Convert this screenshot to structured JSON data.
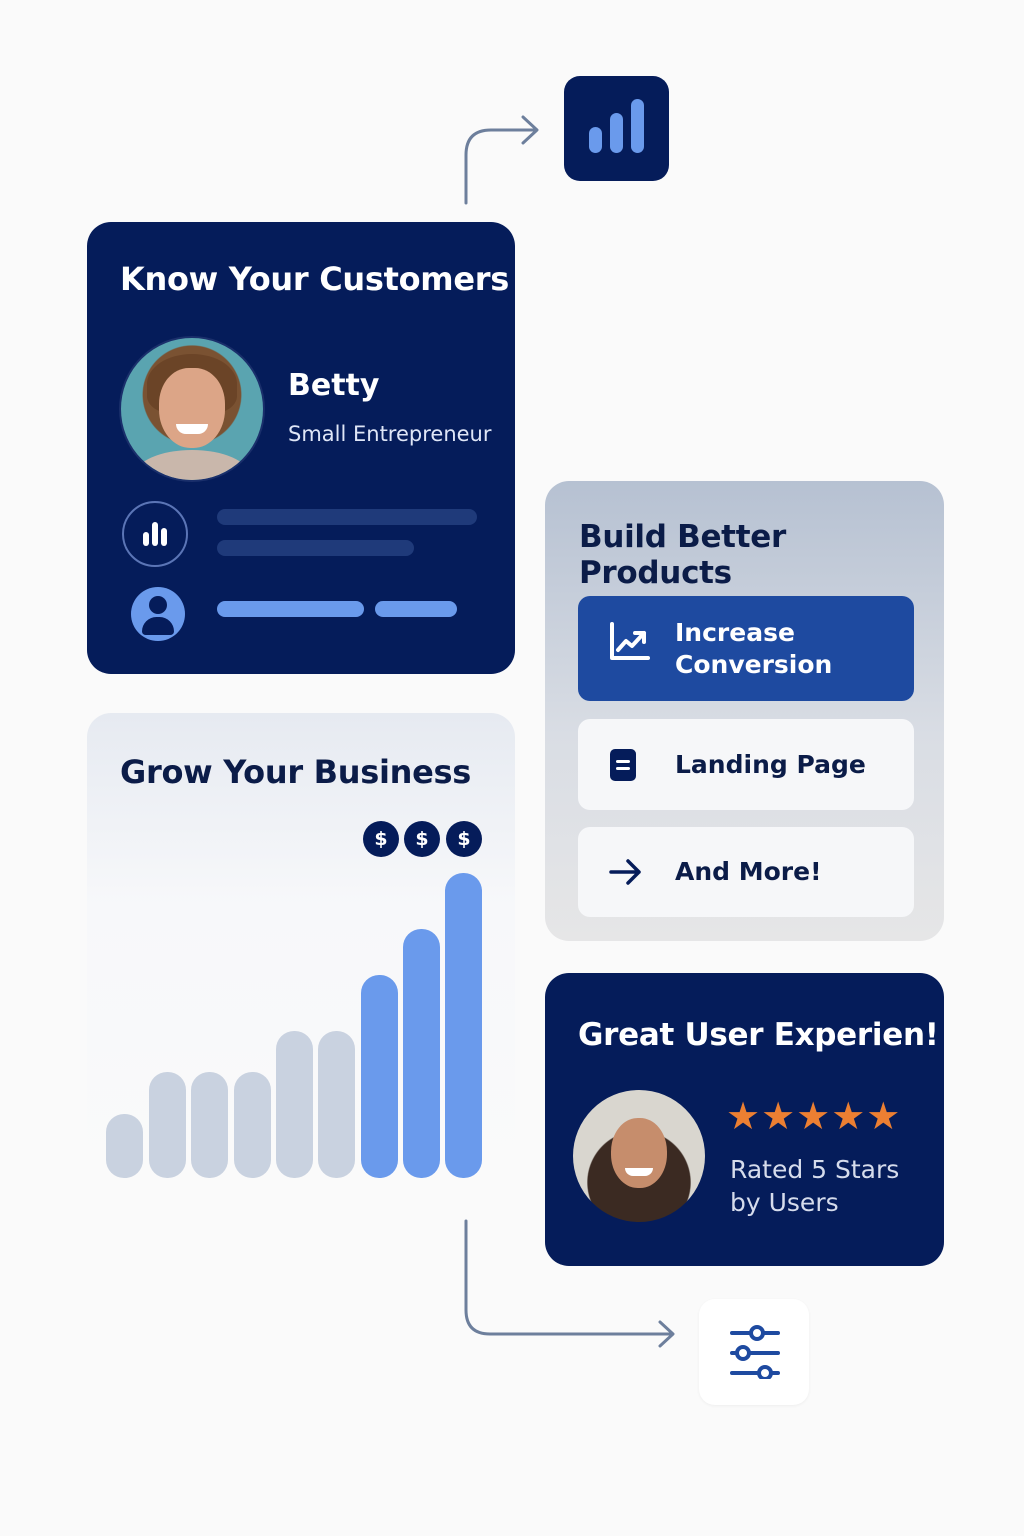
{
  "know_card": {
    "title": "Know Your Customers",
    "persona": {
      "name": "Betty",
      "role": "Small Entrepreneur"
    }
  },
  "grow_card": {
    "title": "Grow Your Business",
    "coins": [
      "$",
      "$",
      "$"
    ]
  },
  "build_card": {
    "title": "Build Better Products",
    "options": [
      {
        "label_line1": "Increase",
        "label_line2": "Conversion",
        "icon": "trending-up-icon",
        "selected": true
      },
      {
        "label": "Landing Page",
        "icon": "document-icon",
        "selected": false
      },
      {
        "label": "And More!",
        "icon": "arrow-right-icon",
        "selected": false
      }
    ]
  },
  "ux_card": {
    "title": "Great User Experien!",
    "stars": "★★★★★",
    "rating_line1": "Rated 5 Stars",
    "rating_line2": "by Users",
    "rating_value": 5
  },
  "icons": {
    "top_tile": "bar-chart-icon",
    "bottom_tile": "sliders-icon"
  },
  "colors": {
    "navy": "#051c5a",
    "accent_blue": "#6a9aec",
    "selected_blue": "#1e4aa0",
    "star_orange": "#ec7f32",
    "muted_bar": "#c9d2e0"
  }
}
